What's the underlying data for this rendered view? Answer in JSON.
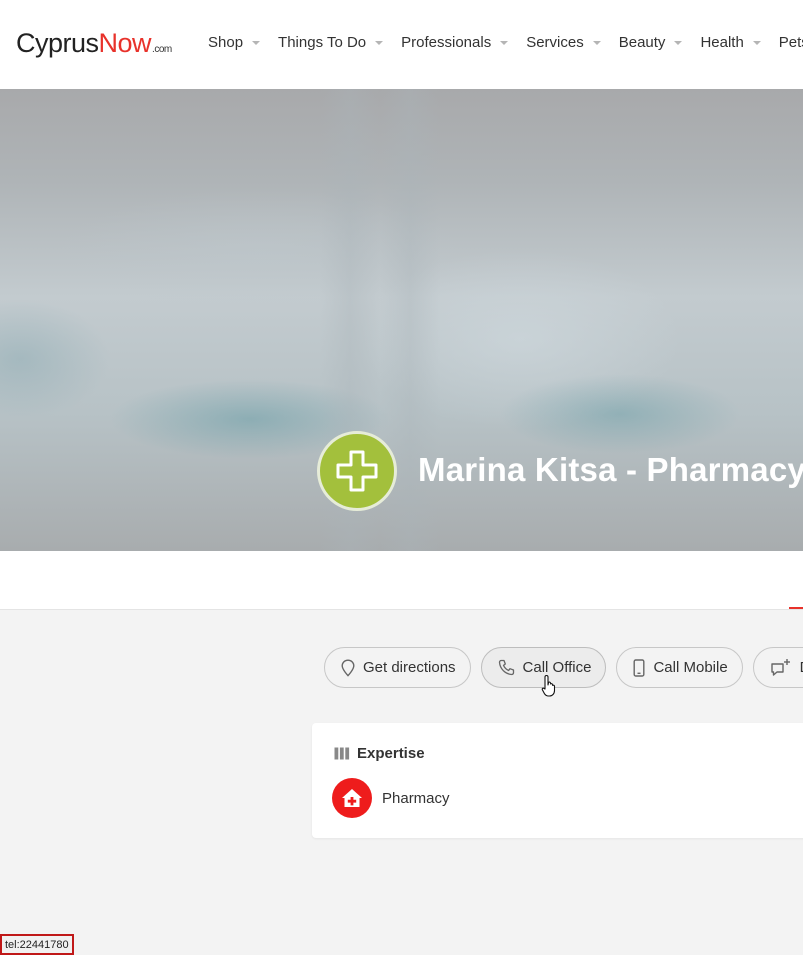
{
  "header": {
    "logo": {
      "part1": "Cyprus",
      "part2": "Now",
      "suffix": ".com"
    },
    "nav": [
      {
        "label": "Shop"
      },
      {
        "label": "Things To Do"
      },
      {
        "label": "Professionals"
      },
      {
        "label": "Services"
      },
      {
        "label": "Beauty"
      },
      {
        "label": "Health"
      },
      {
        "label": "Pets"
      }
    ]
  },
  "hero": {
    "title": "Marina Kitsa - Pharmacy",
    "badge_icon": "medical-cross-icon",
    "badge_color": "#a3c03c"
  },
  "actions": {
    "directions": "Get directions",
    "call_office": "Call Office",
    "call_mobile": "Call Mobile",
    "fourth": "D"
  },
  "expertise": {
    "heading": "Expertise",
    "items": [
      {
        "label": "Pharmacy",
        "icon": "house-medical-icon",
        "color": "#ee1c1c"
      }
    ]
  },
  "status_bar": {
    "url": "tel:22441780"
  },
  "colors": {
    "accent": "#e8322b"
  }
}
